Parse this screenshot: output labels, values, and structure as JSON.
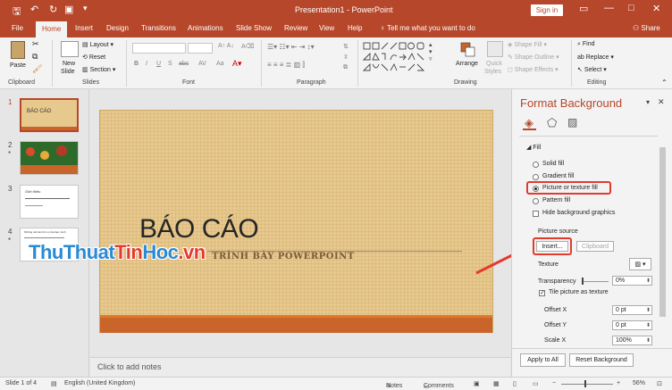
{
  "titlebar": {
    "title": "Presentation1  -  PowerPoint",
    "signin": "Sign in",
    "colors": {
      "brand": "#b7472a"
    }
  },
  "tabs": [
    "File",
    "Home",
    "Insert",
    "Design",
    "Transitions",
    "Animations",
    "Slide Show",
    "Review",
    "View",
    "Help"
  ],
  "tellme": "Tell me what you want to do",
  "share": "Share",
  "ribbon": {
    "clipboard": {
      "paste": "Paste",
      "label": "Clipboard"
    },
    "slides": {
      "new_slide_1": "New",
      "new_slide_2": "Slide",
      "layout": "Layout",
      "reset": "Reset",
      "section": "Section",
      "label": "Slides"
    },
    "font": {
      "label": "Font",
      "bold": "B",
      "italic": "I",
      "underline": "U",
      "strike": "S",
      "shadow": "abc",
      "spacing": "AV",
      "case": "Aa"
    },
    "paragraph": {
      "label": "Paragraph"
    },
    "drawing": {
      "arrange": "Arrange",
      "quick_styles_1": "Quick",
      "quick_styles_2": "Styles",
      "shape_fill": "Shape Fill",
      "shape_outline": "Shape Outline",
      "shape_effects": "Shape Effects",
      "label": "Drawing"
    },
    "editing": {
      "find": "Find",
      "replace": "Replace",
      "select": "Select",
      "label": "Editing"
    }
  },
  "thumbnails": [
    {
      "num": "1",
      "title": "BÁO CÁO",
      "star": ""
    },
    {
      "num": "2",
      "title": "",
      "star": "*"
    },
    {
      "num": "3",
      "title": "Giới thiệu",
      "star": ""
    },
    {
      "num": "4",
      "title": "Những cái bàn thú vị của bạn mình",
      "star": "*"
    }
  ],
  "slide": {
    "title": "BÁO CÁO",
    "subtitle": "TRÌNH BÀY POWERPOINT",
    "notes_placeholder": "Click to add notes"
  },
  "watermark": {
    "part1": "Thu",
    "part2": "Thuat",
    "part3": "Tin",
    "part4": "Hoc",
    "part5": ".vn"
  },
  "format_pane": {
    "title": "Format Background",
    "fill_header": "Fill",
    "solid_fill": "Solid fill",
    "gradient_fill": "Gradient fill",
    "picture_fill": "Picture or texture fill",
    "pattern_fill": "Pattern fill",
    "hide_bg": "Hide background graphics",
    "picture_source": "Picture source",
    "insert_btn": "Insert...",
    "clipboard_btn": "Clipboard",
    "texture": "Texture",
    "transparency": "Transparency",
    "transparency_val": "0%",
    "tile": "Tile picture as texture",
    "tile_check": "✓",
    "offset_x": "Offset X",
    "offset_x_val": "0 pt",
    "offset_y": "Offset Y",
    "offset_y_val": "0 pt",
    "scale_x": "Scale X",
    "scale_x_val": "100%",
    "apply_all": "Apply to All",
    "reset_bg": "Reset Background"
  },
  "status": {
    "slide_of": "Slide 1 of 4",
    "language": "English (United Kingdom)",
    "notes": "Notes",
    "comments": "Comments",
    "zoom": "56%"
  }
}
